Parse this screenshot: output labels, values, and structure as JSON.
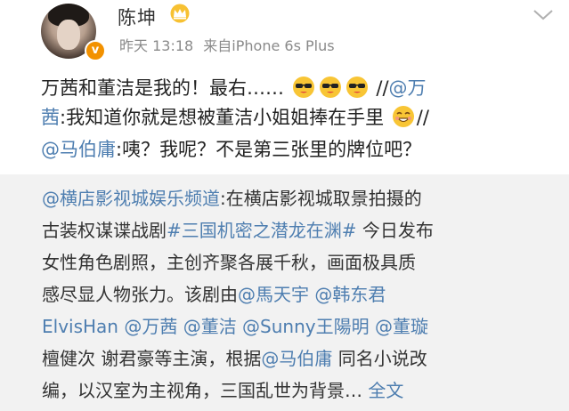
{
  "author": {
    "name": "陈坤",
    "time": "昨天 13:18",
    "source": "来自iPhone 6s Plus",
    "verified_mark": "v"
  },
  "post": {
    "line1_text": "万茜和董洁是我的！最右……",
    "line1_sep": "//",
    "line1_mention": "@万",
    "line2_mention": "茜",
    "line2_text": ":我知道你就是想被董洁小姐姐捧在手里",
    "line2_sep": "//",
    "line3_mention": "@马伯庸",
    "line3_text": ":咦？我呢？不是第三张里的牌位吧？"
  },
  "repost": {
    "r1_mention": "@横店影视城娱乐频道",
    "r1_text": ":在横店影视城取景拍摄的",
    "r2_text": "古装权谋谍战剧",
    "r2_topic": "#三国机密之潜龙在渊#",
    "r2_text2": " 今日发布",
    "r3_text": "女性角色剧照，主创齐聚各展千秋，画面极具质",
    "r4_text": "感尽显人物张力。该剧由",
    "r4_mention1": "@馬天宇",
    "r4_mention2": " @韩东君",
    "r5_mention1": "ElvisHan",
    "r5_mention2": " @万茜",
    "r5_mention3": " @董洁",
    "r5_mention4": " @Sunny王陽明",
    "r5_mention5": " @董璇",
    "r6_text": "檀健次 谢君豪等主演，根据",
    "r6_mention": "@马伯庸",
    "r6_text2": " 同名小说改",
    "r7_text": "编，以汉室为主视角，三国乱世为背景… ",
    "r7_link": "全文"
  },
  "icons": {
    "avatar": "avatar-photo",
    "verified": "verified-badge-icon",
    "crown": "crown-icon",
    "chevron": "chevron-down-icon",
    "emoji_cool": "sunglasses-emoji-icon",
    "emoji_smile": "grin-emoji-icon"
  },
  "colors": {
    "link": "#4e7eb0",
    "verified": "#f29100",
    "repost_bg": "#f2f2f2",
    "meta": "#8a8a8a"
  }
}
